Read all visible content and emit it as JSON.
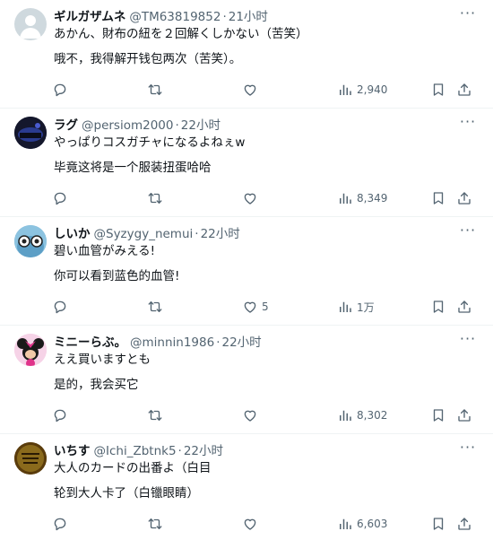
{
  "colors": {
    "text": "#0f1419",
    "muted": "#536471",
    "divider": "#eff3f4"
  },
  "icons": [
    "more-icon",
    "reply-icon",
    "retweet-icon",
    "like-icon",
    "views-icon",
    "bookmark-icon",
    "share-icon"
  ],
  "posts": [
    {
      "name": "ギルガザムネ",
      "handle": "@TM63819852",
      "time": "21小时",
      "text": "あかん、財布の紐を２回解くしかない（苦笑）",
      "translation": "哦不，我得解开钱包两次（苦笑）。",
      "likes": "",
      "views": "2,940"
    },
    {
      "name": "ラグ",
      "handle": "@persiom2000",
      "time": "22小时",
      "text": "やっぱりコスガチャになるよねぇw",
      "translation": "毕竟这将是一个服装扭蛋哈哈",
      "likes": "",
      "views": "8,349"
    },
    {
      "name": "しいか",
      "handle": "@Syzygy_nemui",
      "time": "22小时",
      "text": "碧い血管がみえる!",
      "translation": "你可以看到蓝色的血管!",
      "likes": "5",
      "views": "1万"
    },
    {
      "name": "ミニーらぶ。",
      "handle": "@minnin1986",
      "time": "22小时",
      "text": "ええ買いますとも",
      "translation": "是的，我会买它",
      "likes": "",
      "views": "8,302"
    },
    {
      "name": "いちす",
      "handle": "@Ichi_Zbtnk5",
      "time": "22小时",
      "text": "大人のカードの出番よ（白目",
      "translation": "轮到大人卡了（白镴眼睛）",
      "likes": "",
      "views": "6,603"
    }
  ]
}
